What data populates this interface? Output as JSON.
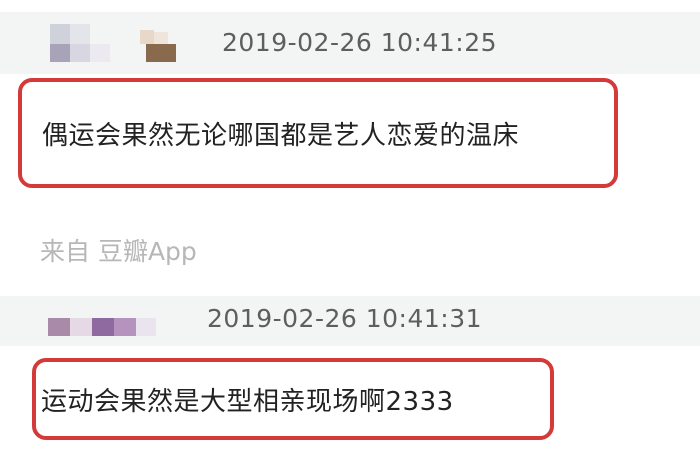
{
  "comments": [
    {
      "timestamp": "2019-02-26 10:41:25",
      "text": "偶运会果然无论哪国都是艺人恋爱的温床"
    },
    {
      "timestamp": "2019-02-26 10:41:31",
      "text": "运动会果然是大型相亲现场啊2333"
    }
  ],
  "source_label": "来自 豆瓣App",
  "colors": {
    "highlight_border": "#d43a3a",
    "header_band": "#f3f4f4",
    "timestamp_text": "#5e5e5e",
    "source_text": "#b7b7b7"
  }
}
